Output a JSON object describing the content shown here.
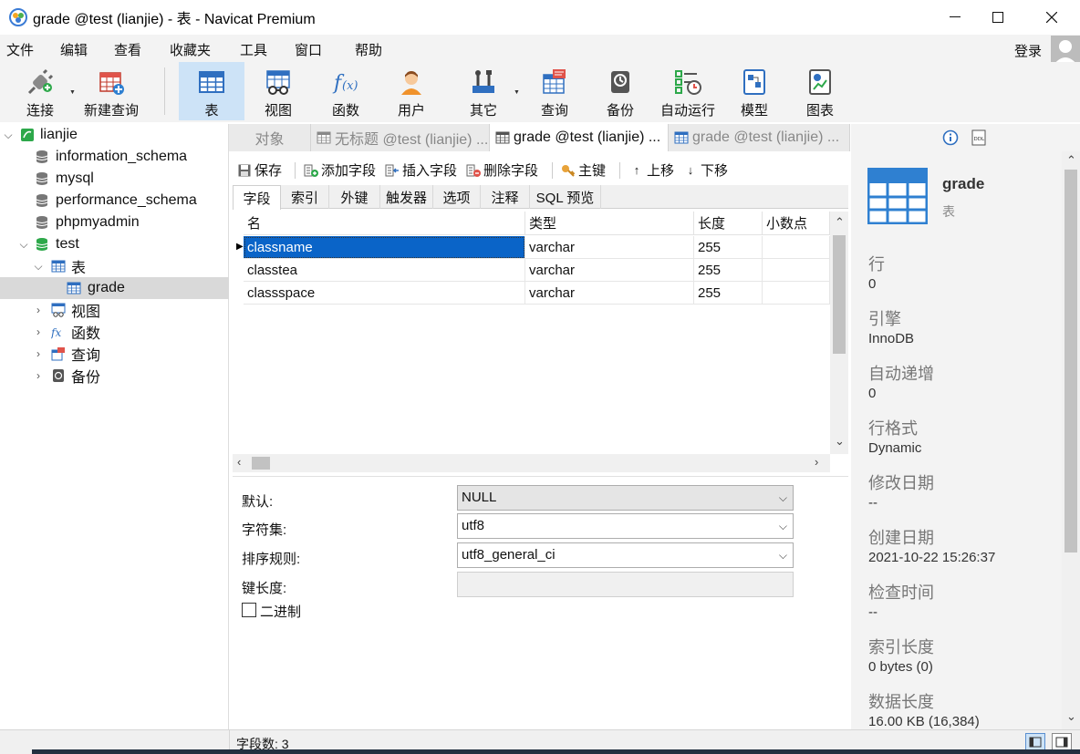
{
  "window": {
    "title": "grade @test (lianjie) - 表 - Navicat Premium"
  },
  "menu": [
    "文件",
    "编辑",
    "查看",
    "收藏夹",
    "工具",
    "窗口",
    "帮助"
  ],
  "account": {
    "login_label": "登录"
  },
  "toolbar": {
    "buttons": [
      {
        "label": "连接",
        "icon": "plug-icon"
      },
      {
        "label": "新建查询",
        "icon": "new-query-icon"
      },
      {
        "label": "表",
        "icon": "table-icon",
        "active": true
      },
      {
        "label": "视图",
        "icon": "view-icon"
      },
      {
        "label": "函数",
        "icon": "function-icon"
      },
      {
        "label": "用户",
        "icon": "user-icon"
      },
      {
        "label": "其它",
        "icon": "tools-icon"
      },
      {
        "label": "查询",
        "icon": "query-icon"
      },
      {
        "label": "备份",
        "icon": "backup-icon"
      },
      {
        "label": "自动运行",
        "icon": "schedule-icon"
      },
      {
        "label": "模型",
        "icon": "model-icon"
      },
      {
        "label": "图表",
        "icon": "chart-icon"
      }
    ]
  },
  "tree": {
    "connection": "lianjie",
    "databases": [
      "information_schema",
      "mysql",
      "performance_schema",
      "phpmyadmin",
      "test"
    ],
    "test_children": {
      "tables_label": "表",
      "table_item": "grade",
      "views_label": "视图",
      "functions_label": "函数",
      "queries_label": "查询",
      "backups_label": "备份"
    }
  },
  "tabs": [
    {
      "label": "对象"
    },
    {
      "label": "无标题 @test (lianjie) ..."
    },
    {
      "label": "grade @test (lianjie) ..."
    },
    {
      "label": "grade @test (lianjie) ..."
    }
  ],
  "object_toolbar": {
    "save": "保存",
    "add_field": "添加字段",
    "insert_field": "插入字段",
    "delete_field": "删除字段",
    "primary_key": "主键",
    "move_up": "上移",
    "move_down": "下移"
  },
  "design_tabs": [
    "字段",
    "索引",
    "外键",
    "触发器",
    "选项",
    "注释",
    "SQL 预览"
  ],
  "fields_grid": {
    "columns": [
      "名",
      "类型",
      "长度",
      "小数点"
    ],
    "rows": [
      {
        "name": "classname",
        "type": "varchar",
        "length": "255",
        "decimals": ""
      },
      {
        "name": "classtea",
        "type": "varchar",
        "length": "255",
        "decimals": ""
      },
      {
        "name": "classspace",
        "type": "varchar",
        "length": "255",
        "decimals": ""
      }
    ]
  },
  "field_props": {
    "default_label": "默认:",
    "default_value": "NULL",
    "charset_label": "字符集:",
    "charset_value": "utf8",
    "collation_label": "排序规则:",
    "collation_value": "utf8_general_ci",
    "key_length_label": "键长度:",
    "key_length_value": "",
    "binary_label": "二进制",
    "binary_checked": false
  },
  "info_panel": {
    "name": "grade",
    "type": "表",
    "items": [
      {
        "key": "行",
        "value": "0"
      },
      {
        "key": "引擎",
        "value": "InnoDB"
      },
      {
        "key": "自动递增",
        "value": "0"
      },
      {
        "key": "行格式",
        "value": "Dynamic"
      },
      {
        "key": "修改日期",
        "value": "--"
      },
      {
        "key": "创建日期",
        "value": "2021-10-22 15:26:37"
      },
      {
        "key": "检查时间",
        "value": "--"
      },
      {
        "key": "索引长度",
        "value": "0 bytes (0)"
      },
      {
        "key": "数据长度",
        "value": "16.00 KB (16,384)"
      }
    ]
  },
  "status": {
    "field_count": "字段数: 3"
  },
  "colors": {
    "accent": "#0a64c8",
    "active_tool": "#cde3f7",
    "db_green": "#2da84a"
  }
}
